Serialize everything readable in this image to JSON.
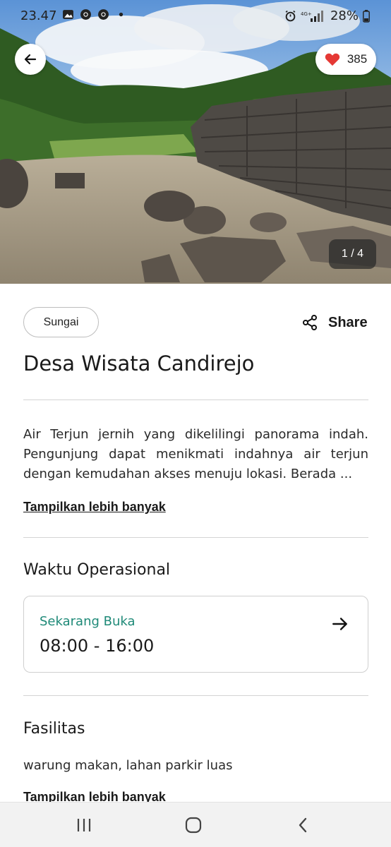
{
  "status_bar": {
    "time": "23.47",
    "battery": "28%",
    "left_icons": [
      "gallery-icon",
      "chrome-icon",
      "chrome-icon",
      "dot-icon"
    ],
    "right_icons": [
      "alarm-icon",
      "4g-signal-icon",
      "battery-icon"
    ]
  },
  "hero": {
    "favorite_count": "385",
    "page_counter": "1 / 4",
    "favorite_color": "#e53935"
  },
  "place": {
    "category": "Sungai",
    "share_label": "Share",
    "title": "Desa Wisata Candirejo",
    "description": "Air Terjun jernih yang dikelilingi panorama indah. Pengunjung dapat menikmati indahnya air terjun dengan kemudahan akses menuju lokasi. Berada ...",
    "show_more_label": "Tampilkan lebih banyak"
  },
  "hours": {
    "section_title": "Waktu Operasional",
    "status": "Sekarang Buka",
    "time_range": "08:00 - 16:00",
    "status_color": "#1f8a78"
  },
  "facilities": {
    "section_title": "Fasilitas",
    "items_text": "warung makan, lahan parkir luas",
    "show_more_label": "Tampilkan lebih banyak"
  },
  "nav": {
    "icons": [
      "recents-icon",
      "home-icon",
      "back-nav-icon"
    ]
  }
}
